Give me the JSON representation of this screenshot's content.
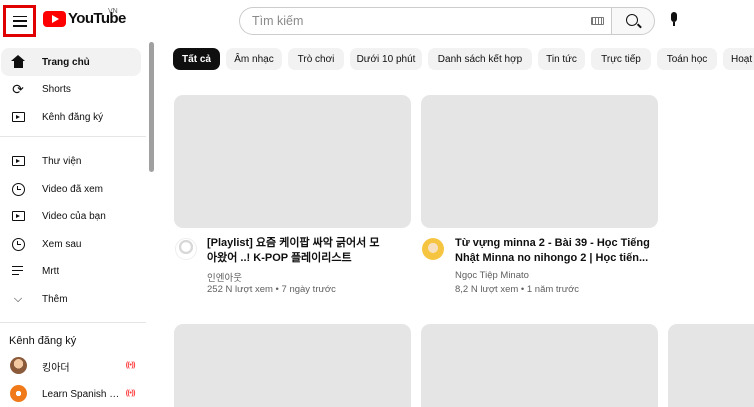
{
  "header": {
    "logo_text": "YouTube",
    "country_code": "VN",
    "search_placeholder": "Tìm kiếm"
  },
  "sidebar": {
    "items": [
      {
        "label": "Trang chủ",
        "icon": "home-icon"
      },
      {
        "label": "Shorts",
        "icon": "shorts-icon"
      },
      {
        "label": "Kênh đăng ký",
        "icon": "subscriptions-icon"
      },
      {
        "label": "Thư viện",
        "icon": "library-icon"
      },
      {
        "label": "Video đã xem",
        "icon": "history-icon"
      },
      {
        "label": "Video của bạn",
        "icon": "your-videos-icon"
      },
      {
        "label": "Xem sau",
        "icon": "watch-later-icon"
      },
      {
        "label": "Mrtt",
        "icon": "playlist-icon"
      },
      {
        "label": "Thêm",
        "icon": "chevron-down-icon"
      }
    ],
    "subscriptions_heading": "Kênh đăng ký",
    "subscriptions": [
      {
        "name": "킹아더",
        "live": "((•))"
      },
      {
        "name": "Learn Spanish wi...",
        "live": "((•))"
      }
    ]
  },
  "chips": [
    "Tất cả",
    "Âm nhạc",
    "Trò chơi",
    "Dưới 10 phút",
    "Danh sách kết hợp",
    "Tin tức",
    "Trực tiếp",
    "Toán học",
    "Hoạt"
  ],
  "videos": [
    {
      "title_line1": "[Playlist] 요즘 케이팝 싸악 긁어서 모",
      "title_line2": "아왔어 ..! K-POP 플레이리스트",
      "channel": "인엔아웃",
      "meta": "252 N lượt xem • 7 ngày trước"
    },
    {
      "title_line1": "Từ vựng minna 2 - Bài 39 - Học Tiếng",
      "title_line2": "Nhật Minna no nihongo 2 | Học tiến...",
      "channel": "Ngọc Tiệp Minato",
      "meta": "8,2 N lượt xem • 1 năm trước"
    }
  ],
  "colors": {
    "brand_red": "#ff0000",
    "highlight_border": "#e00000",
    "thumb_placeholder": "#e5e5e5",
    "chip_bg": "#f2f2f2"
  }
}
